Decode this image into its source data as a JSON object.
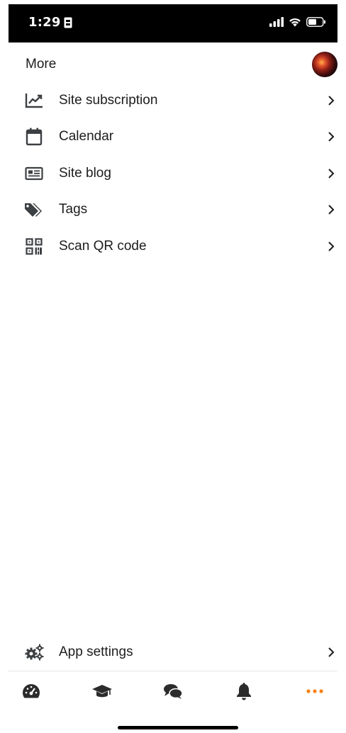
{
  "status_bar": {
    "time": "1:29"
  },
  "header": {
    "title": "More"
  },
  "menu": {
    "items": [
      {
        "label": "Site subscription",
        "icon": "chart-line-icon"
      },
      {
        "label": "Calendar",
        "icon": "calendar-icon"
      },
      {
        "label": "Site blog",
        "icon": "newspaper-icon"
      },
      {
        "label": "Tags",
        "icon": "tags-icon"
      },
      {
        "label": "Scan QR code",
        "icon": "qrcode-icon"
      }
    ]
  },
  "settings": {
    "label": "App settings",
    "icon": "cogs-icon"
  },
  "tabbar": {
    "tabs": [
      {
        "icon": "dashboard-icon"
      },
      {
        "icon": "graduation-cap-icon"
      },
      {
        "icon": "comments-icon"
      },
      {
        "icon": "bell-icon"
      },
      {
        "icon": "more-icon",
        "active": true
      }
    ]
  },
  "colors": {
    "accent": "#f98012",
    "icon": "#3c4043",
    "text": "#1d1d1f"
  }
}
